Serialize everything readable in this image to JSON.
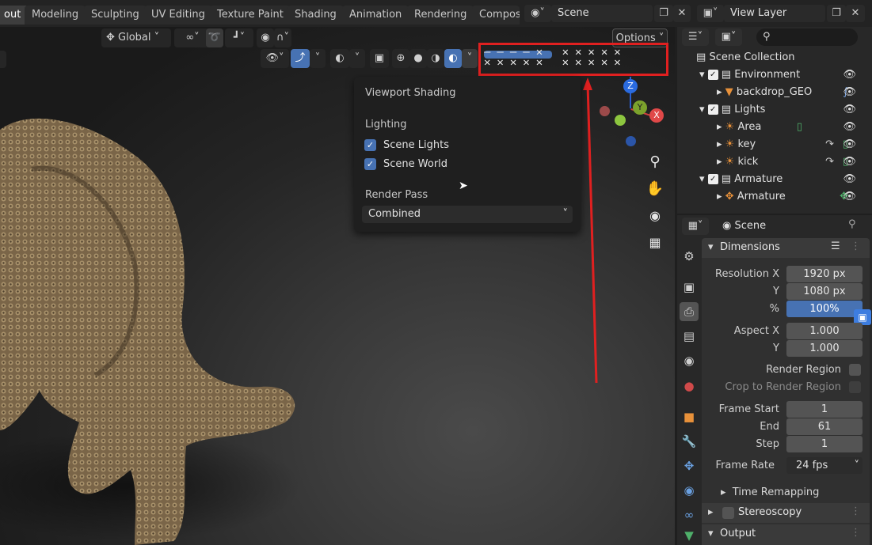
{
  "workspace_tabs": [
    "out",
    "Modeling",
    "Sculpting",
    "UV Editing",
    "Texture Paint",
    "Shading",
    "Animation",
    "Rendering",
    "Compos"
  ],
  "scene_field": "Scene",
  "view_layer_field": "View Layer",
  "viewport_header": {
    "orientation": "Global",
    "options": "Options"
  },
  "shading_popup": {
    "title": "Viewport Shading",
    "lighting_label": "Lighting",
    "scene_lights": "Scene Lights",
    "scene_world": "Scene World",
    "render_pass_label": "Render Pass",
    "render_pass_value": "Combined"
  },
  "gizmo": {
    "z": "Z",
    "y": "Y",
    "x": "X"
  },
  "outliner": {
    "root": "Scene Collection",
    "items": [
      {
        "name": "Environment"
      },
      {
        "name": "backdrop_GEO"
      },
      {
        "name": "Lights"
      },
      {
        "name": "Area"
      },
      {
        "name": "key"
      },
      {
        "name": "kick"
      },
      {
        "name": "Armature"
      },
      {
        "name": "Armature"
      }
    ]
  },
  "properties": {
    "context": "Scene",
    "dimensions_title": "Dimensions",
    "resolution_x_label": "Resolution X",
    "resolution_x": "1920 px",
    "y_label": "Y",
    "resolution_y": "1080 px",
    "pct_label": "%",
    "resolution_pct": "100%",
    "aspect_x_label": "Aspect X",
    "aspect_x": "1.000",
    "aspect_y": "1.000",
    "render_region": "Render Region",
    "crop_region": "Crop to Render Region",
    "frame_start_label": "Frame Start",
    "frame_start": "1",
    "end_label": "End",
    "frame_end": "61",
    "step_label": "Step",
    "frame_step": "1",
    "frame_rate_label": "Frame Rate",
    "frame_rate": "24 fps",
    "time_remapping": "Time Remapping",
    "stereoscopy": "Stereoscopy",
    "output": "Output"
  },
  "colors": {
    "accent": "#4772b3",
    "highlight_box": "#e02020"
  }
}
